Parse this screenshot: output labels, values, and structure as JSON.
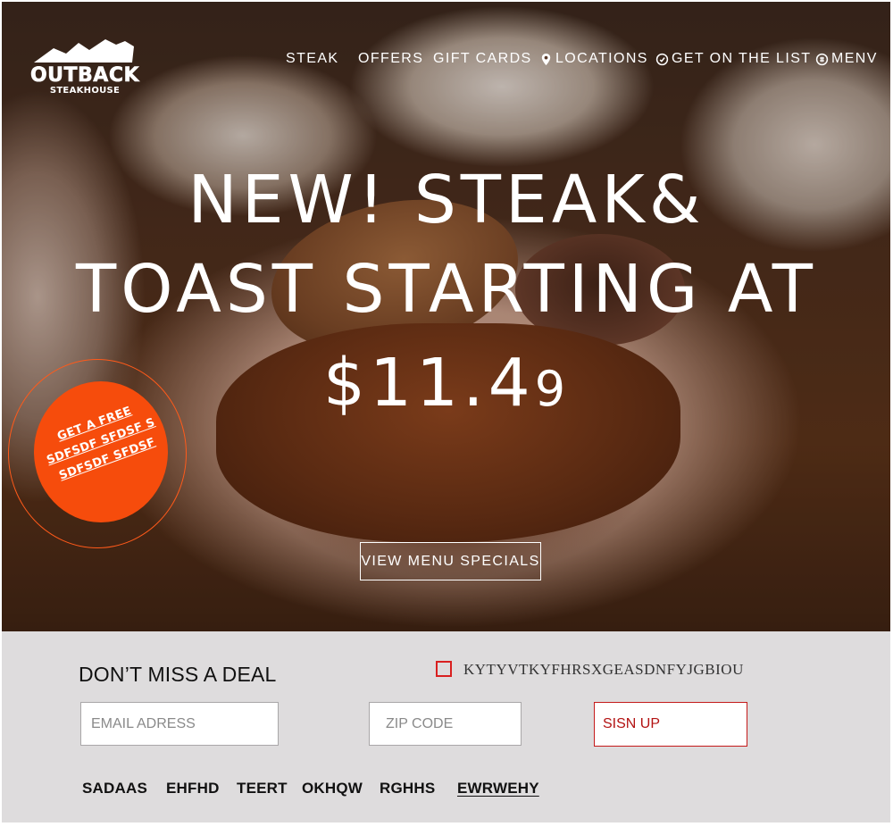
{
  "brand": {
    "name": "OUTBACK",
    "tagline": "STEAKHOUSE"
  },
  "nav": {
    "items": [
      {
        "label": "STEAK"
      },
      {
        "label": "OFFERS"
      },
      {
        "label": "GIFT CARDS"
      },
      {
        "label": "LOCATIONS",
        "icon": "location-pin-icon"
      },
      {
        "label": "GET ON THE LIST",
        "icon": "list-icon"
      },
      {
        "label": "MENV",
        "icon": "menu-icon"
      }
    ]
  },
  "hero": {
    "line1": "NEW! STEAK&",
    "line2": "TOAST STARTING AT",
    "price_main": "$11.4",
    "price_cents": "9",
    "cta_label": "VIEW MENU SPECIALS",
    "promo": {
      "line1": "GET A FREE",
      "line2": "SDFSDF SFDSF S",
      "line3": "SDFSDF SFDSF"
    }
  },
  "signup": {
    "title": "DON’T MISS A DEAL",
    "checkbox_label": "KYTYVTKYFHRSXGEASDNFYJGBIOU",
    "email_placeholder": "EMAIL ADRESS",
    "zip_placeholder": "ZIP CODE",
    "button_label": "SISN UP",
    "links": [
      "SADAAS",
      "EHFHD",
      "TEERT",
      "OKHQW",
      "RGHHS",
      "EWRWEHY"
    ]
  },
  "colors": {
    "accent_orange": "#f64c0c",
    "signup_bg": "#dedcdd",
    "button_red": "#c41a1a"
  }
}
